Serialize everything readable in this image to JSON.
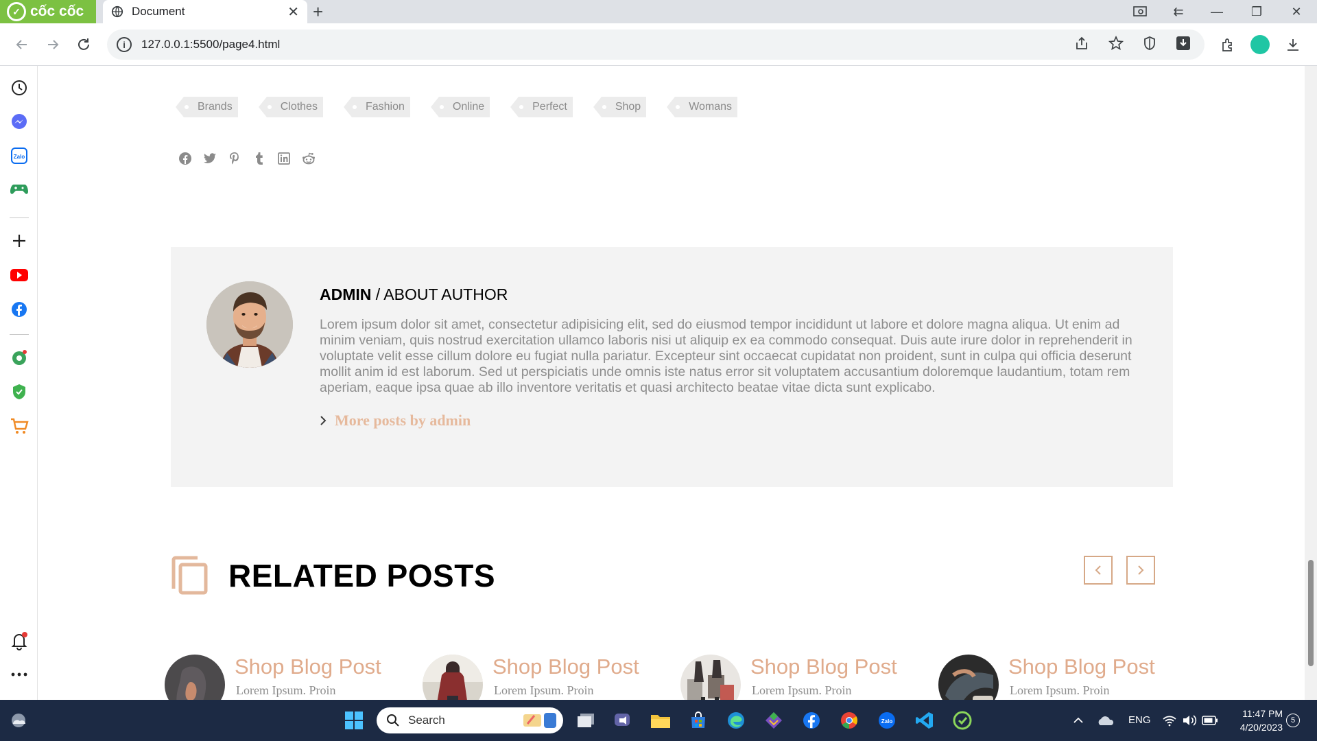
{
  "browser": {
    "brand_label": "cốc cốc",
    "tab_title": "Document",
    "url": "127.0.0.1:5500/page4.html"
  },
  "tags": [
    "Brands",
    "Clothes",
    "Fashion",
    "Online",
    "Perfect",
    "Shop",
    "Womans"
  ],
  "share_icons": [
    "facebook-icon",
    "twitter-icon",
    "pinterest-icon",
    "tumblr-icon",
    "linkedin-icon",
    "reddit-icon"
  ],
  "author": {
    "name": "ADMIN",
    "about_label": "/ ABOUT AUTHOR",
    "bio": "Lorem ipsum dolor sit amet, consectetur adipisicing elit, sed do eiusmod tempor incididunt ut labore et dolore magna aliqua. Ut enim ad minim veniam, quis nostrud exercitation ullamco laboris nisi ut aliquip ex ea commodo consequat. Duis aute irure dolor in reprehenderit in voluptate velit esse cillum dolore eu fugiat nulla pariatur. Excepteur sint occaecat cupidatat non proident, sunt in culpa qui officia deserunt mollit anim id est laborum. Sed ut perspiciatis unde omnis iste natus error sit voluptatem accusantium doloremque laudantium, totam rem aperiam, eaque ipsa quae ab illo inventore veritatis et quasi architecto beatae vitae dicta sunt explicabo.",
    "more_link": "More posts by admin"
  },
  "related": {
    "heading": "RELATED POSTS",
    "posts": [
      {
        "title": "Shop Blog Post",
        "excerpt": "Lorem Ipsum. Proin"
      },
      {
        "title": "Shop Blog Post",
        "excerpt": "Lorem Ipsum. Proin"
      },
      {
        "title": "Shop Blog Post",
        "excerpt": "Lorem Ipsum. Proin"
      },
      {
        "title": "Shop Blog Post",
        "excerpt": "Lorem Ipsum. Proin"
      }
    ]
  },
  "taskbar": {
    "search_placeholder": "Search",
    "language": "ENG",
    "time": "11:47 PM",
    "date": "4/20/2023",
    "notification_count": "5"
  },
  "colors": {
    "accent": "#e0ab8c",
    "author_bg": "#f3f3f3",
    "taskbar_bg": "#1c2a44",
    "brand_green": "#7cc142"
  }
}
